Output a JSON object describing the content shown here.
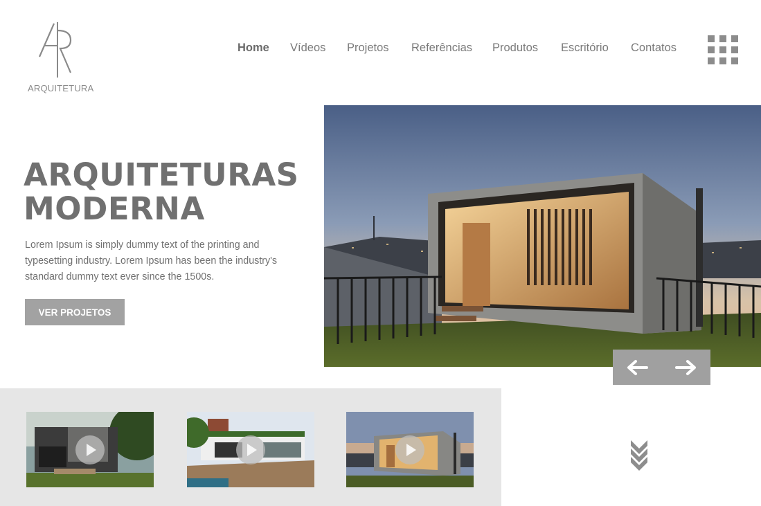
{
  "brand": {
    "name": "ARQUITETURA",
    "monogram": "AR"
  },
  "nav": {
    "items": [
      {
        "label": "Home",
        "active": true
      },
      {
        "label": "Vídeos",
        "active": false
      },
      {
        "label": "Projetos",
        "active": false
      },
      {
        "label": "Referências",
        "active": false
      },
      {
        "label": "Produtos",
        "active": false
      },
      {
        "label": "Escritório",
        "active": false
      },
      {
        "label": "Contatos",
        "active": false
      }
    ],
    "menu_icon": "grid-menu-icon"
  },
  "hero": {
    "title_line1": "ARQUITETURAS",
    "title_line2": "MODERNA",
    "description": "Lorem Ipsum is simply dummy text of the printing and typesetting industry. Lorem Ipsum has been the industry's standard dummy text ever since the 1500s.",
    "cta_label": "VER PROJETOS",
    "image_alt": "modern-house-photo"
  },
  "slider": {
    "prev_icon": "arrow-left-icon",
    "next_icon": "arrow-right-icon"
  },
  "videos": [
    {
      "icon": "play-icon",
      "scene": "dark-modern-house"
    },
    {
      "icon": "play-icon",
      "scene": "house-with-garden-deck"
    },
    {
      "icon": "play-icon",
      "scene": "glass-box-house-dusk"
    }
  ],
  "scroll_icon": "chevron-double-down-icon",
  "colors": {
    "text_gray": "#707070",
    "button_gray": "#a2a2a2",
    "strip_bg": "#e6e6e6",
    "control_gray": "#a0a0a0"
  }
}
